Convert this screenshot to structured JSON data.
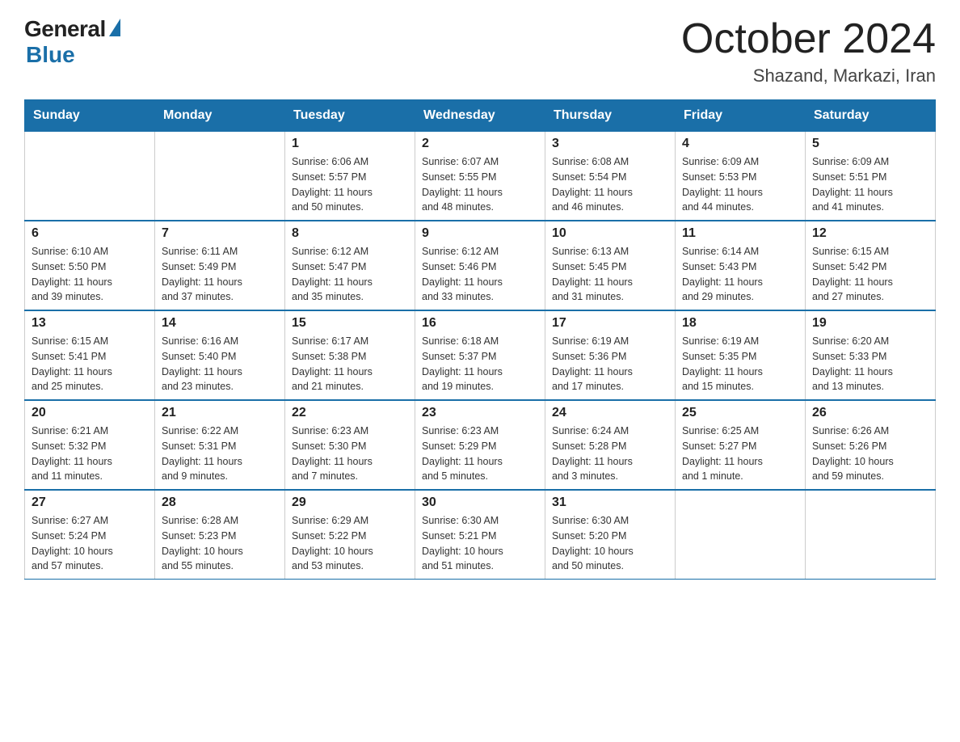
{
  "header": {
    "logo_general": "General",
    "logo_blue": "Blue",
    "month_title": "October 2024",
    "location": "Shazand, Markazi, Iran"
  },
  "weekdays": [
    "Sunday",
    "Monday",
    "Tuesday",
    "Wednesday",
    "Thursday",
    "Friday",
    "Saturday"
  ],
  "weeks": [
    [
      {
        "day": "",
        "info": ""
      },
      {
        "day": "",
        "info": ""
      },
      {
        "day": "1",
        "info": "Sunrise: 6:06 AM\nSunset: 5:57 PM\nDaylight: 11 hours\nand 50 minutes."
      },
      {
        "day": "2",
        "info": "Sunrise: 6:07 AM\nSunset: 5:55 PM\nDaylight: 11 hours\nand 48 minutes."
      },
      {
        "day": "3",
        "info": "Sunrise: 6:08 AM\nSunset: 5:54 PM\nDaylight: 11 hours\nand 46 minutes."
      },
      {
        "day": "4",
        "info": "Sunrise: 6:09 AM\nSunset: 5:53 PM\nDaylight: 11 hours\nand 44 minutes."
      },
      {
        "day": "5",
        "info": "Sunrise: 6:09 AM\nSunset: 5:51 PM\nDaylight: 11 hours\nand 41 minutes."
      }
    ],
    [
      {
        "day": "6",
        "info": "Sunrise: 6:10 AM\nSunset: 5:50 PM\nDaylight: 11 hours\nand 39 minutes."
      },
      {
        "day": "7",
        "info": "Sunrise: 6:11 AM\nSunset: 5:49 PM\nDaylight: 11 hours\nand 37 minutes."
      },
      {
        "day": "8",
        "info": "Sunrise: 6:12 AM\nSunset: 5:47 PM\nDaylight: 11 hours\nand 35 minutes."
      },
      {
        "day": "9",
        "info": "Sunrise: 6:12 AM\nSunset: 5:46 PM\nDaylight: 11 hours\nand 33 minutes."
      },
      {
        "day": "10",
        "info": "Sunrise: 6:13 AM\nSunset: 5:45 PM\nDaylight: 11 hours\nand 31 minutes."
      },
      {
        "day": "11",
        "info": "Sunrise: 6:14 AM\nSunset: 5:43 PM\nDaylight: 11 hours\nand 29 minutes."
      },
      {
        "day": "12",
        "info": "Sunrise: 6:15 AM\nSunset: 5:42 PM\nDaylight: 11 hours\nand 27 minutes."
      }
    ],
    [
      {
        "day": "13",
        "info": "Sunrise: 6:15 AM\nSunset: 5:41 PM\nDaylight: 11 hours\nand 25 minutes."
      },
      {
        "day": "14",
        "info": "Sunrise: 6:16 AM\nSunset: 5:40 PM\nDaylight: 11 hours\nand 23 minutes."
      },
      {
        "day": "15",
        "info": "Sunrise: 6:17 AM\nSunset: 5:38 PM\nDaylight: 11 hours\nand 21 minutes."
      },
      {
        "day": "16",
        "info": "Sunrise: 6:18 AM\nSunset: 5:37 PM\nDaylight: 11 hours\nand 19 minutes."
      },
      {
        "day": "17",
        "info": "Sunrise: 6:19 AM\nSunset: 5:36 PM\nDaylight: 11 hours\nand 17 minutes."
      },
      {
        "day": "18",
        "info": "Sunrise: 6:19 AM\nSunset: 5:35 PM\nDaylight: 11 hours\nand 15 minutes."
      },
      {
        "day": "19",
        "info": "Sunrise: 6:20 AM\nSunset: 5:33 PM\nDaylight: 11 hours\nand 13 minutes."
      }
    ],
    [
      {
        "day": "20",
        "info": "Sunrise: 6:21 AM\nSunset: 5:32 PM\nDaylight: 11 hours\nand 11 minutes."
      },
      {
        "day": "21",
        "info": "Sunrise: 6:22 AM\nSunset: 5:31 PM\nDaylight: 11 hours\nand 9 minutes."
      },
      {
        "day": "22",
        "info": "Sunrise: 6:23 AM\nSunset: 5:30 PM\nDaylight: 11 hours\nand 7 minutes."
      },
      {
        "day": "23",
        "info": "Sunrise: 6:23 AM\nSunset: 5:29 PM\nDaylight: 11 hours\nand 5 minutes."
      },
      {
        "day": "24",
        "info": "Sunrise: 6:24 AM\nSunset: 5:28 PM\nDaylight: 11 hours\nand 3 minutes."
      },
      {
        "day": "25",
        "info": "Sunrise: 6:25 AM\nSunset: 5:27 PM\nDaylight: 11 hours\nand 1 minute."
      },
      {
        "day": "26",
        "info": "Sunrise: 6:26 AM\nSunset: 5:26 PM\nDaylight: 10 hours\nand 59 minutes."
      }
    ],
    [
      {
        "day": "27",
        "info": "Sunrise: 6:27 AM\nSunset: 5:24 PM\nDaylight: 10 hours\nand 57 minutes."
      },
      {
        "day": "28",
        "info": "Sunrise: 6:28 AM\nSunset: 5:23 PM\nDaylight: 10 hours\nand 55 minutes."
      },
      {
        "day": "29",
        "info": "Sunrise: 6:29 AM\nSunset: 5:22 PM\nDaylight: 10 hours\nand 53 minutes."
      },
      {
        "day": "30",
        "info": "Sunrise: 6:30 AM\nSunset: 5:21 PM\nDaylight: 10 hours\nand 51 minutes."
      },
      {
        "day": "31",
        "info": "Sunrise: 6:30 AM\nSunset: 5:20 PM\nDaylight: 10 hours\nand 50 minutes."
      },
      {
        "day": "",
        "info": ""
      },
      {
        "day": "",
        "info": ""
      }
    ]
  ]
}
